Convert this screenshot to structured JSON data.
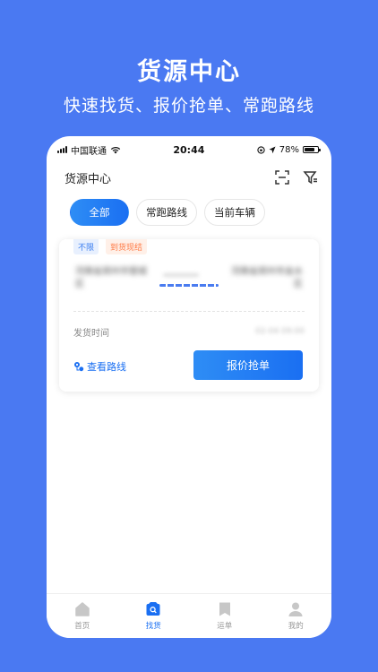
{
  "promo": {
    "title": "货源中心",
    "subtitle": "快速找货、报价抢单、常跑路线"
  },
  "status_bar": {
    "carrier": "中国联通",
    "time": "20:44",
    "battery": "78%",
    "battery_level": 0.78
  },
  "nav": {
    "title": "货源中心",
    "scan_icon": "scan-icon",
    "filter_icon": "filter-icon"
  },
  "filters": [
    {
      "label": "全部",
      "active": true
    },
    {
      "label": "常跑路线",
      "active": false
    },
    {
      "label": "当前车辆",
      "active": false
    }
  ],
  "card": {
    "tag_unlimited": "不限",
    "tag_payment": "到货现结",
    "from": "河南省郑州市管城区",
    "to": "河南省郑州市金水区",
    "ship_time_label": "发货时间",
    "ship_time_value": "02-04 09:00",
    "view_route": "查看路线",
    "quote_button": "报价抢单"
  },
  "tabbar": [
    {
      "label": "首页",
      "icon": "home-icon",
      "active": false
    },
    {
      "label": "找货",
      "icon": "find-goods-icon",
      "active": true
    },
    {
      "label": "运单",
      "icon": "waybill-icon",
      "active": false
    },
    {
      "label": "我的",
      "icon": "profile-icon",
      "active": false
    }
  ],
  "colors": {
    "background": "#4a79f2",
    "accent": "#1a6ff2"
  }
}
